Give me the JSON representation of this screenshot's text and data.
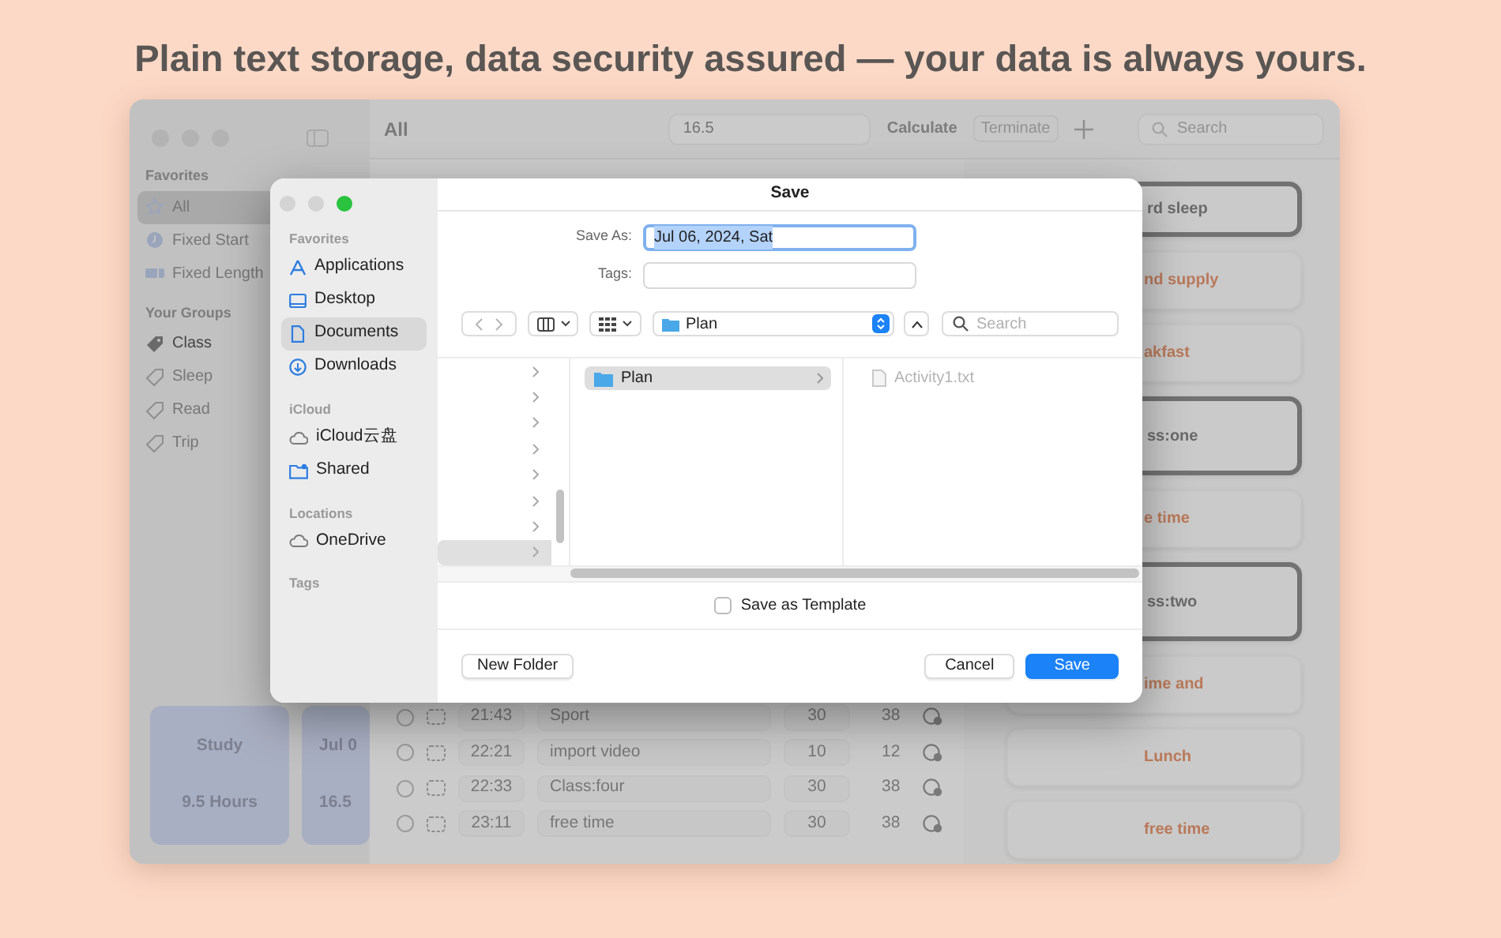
{
  "headline": "Plain text storage, data security assured — your data is always yours.",
  "app": {
    "sidebar": {
      "sections": [
        {
          "title": "Favorites",
          "items": [
            {
              "label": "All",
              "selected": true,
              "dimmed": true
            },
            {
              "label": "Fixed Start",
              "selected": false,
              "dimmed": true
            },
            {
              "label": "Fixed Length",
              "selected": false,
              "dimmed": true
            }
          ]
        },
        {
          "title": "Your Groups",
          "items": [
            {
              "label": "Class",
              "selected": false,
              "dimmed": false
            },
            {
              "label": "Sleep",
              "selected": false,
              "dimmed": true
            },
            {
              "label": "Read",
              "selected": false,
              "dimmed": true
            },
            {
              "label": "Trip",
              "selected": false,
              "dimmed": true
            }
          ]
        }
      ],
      "summary_cards": [
        {
          "title": "Study",
          "value": "9.5 Hours"
        },
        {
          "title": "Jul 0",
          "value": "16.5"
        }
      ]
    },
    "toolbar": {
      "title": "All",
      "value": "16.5",
      "calculate": {
        "label": "Calculate",
        "disabled": false
      },
      "terminate": {
        "label": "Terminate",
        "disabled": true
      },
      "search_placeholder": "Search"
    },
    "rows": [
      {
        "checked": false,
        "time": "21:43",
        "name": "Sport",
        "minutes": "30",
        "total": "38"
      },
      {
        "checked": false,
        "time": "22:21",
        "name": "import video",
        "minutes": "10",
        "total": "12"
      },
      {
        "checked": false,
        "time": "22:33",
        "name": "Class:four",
        "minutes": "30",
        "total": "38"
      },
      {
        "checked": false,
        "time": "23:11",
        "name": "free time",
        "minutes": "30",
        "total": "38"
      }
    ],
    "cards": [
      {
        "label": "rd sleep",
        "selected": true
      },
      {
        "label": "nd supply",
        "selected": false
      },
      {
        "label": "akfast",
        "selected": false
      },
      {
        "label": "ss:one",
        "selected": true
      },
      {
        "label": "e time",
        "selected": false
      },
      {
        "label": "ss:two",
        "selected": true
      },
      {
        "label": "ime and",
        "selected": false
      },
      {
        "label": "Lunch",
        "selected": false
      },
      {
        "label": "free time",
        "selected": false
      }
    ]
  },
  "dialog": {
    "title": "Save",
    "sidebar": [
      {
        "title": "Favorites",
        "items": [
          {
            "label": "Applications",
            "selected": false
          },
          {
            "label": "Desktop",
            "selected": false
          },
          {
            "label": "Documents",
            "selected": true
          },
          {
            "label": "Downloads",
            "selected": false
          }
        ]
      },
      {
        "title": "iCloud",
        "items": [
          {
            "label": "iCloud云盘",
            "selected": false
          },
          {
            "label": "Shared",
            "selected": false
          }
        ]
      },
      {
        "title": "Locations",
        "items": [
          {
            "label": "OneDrive",
            "selected": false
          }
        ]
      },
      {
        "title": "Tags"
      }
    ],
    "save_as": {
      "label": "Save As:",
      "value": "Jul 06, 2024, Sat",
      "selected": true
    },
    "tags": {
      "label": "Tags:"
    },
    "location": "Plan",
    "search_placeholder": "Search",
    "parent_rows": [
      {
        "selected": false
      },
      {
        "selected": false
      },
      {
        "selected": false
      },
      {
        "selected": false
      },
      {
        "selected": false
      },
      {
        "selected": false
      },
      {
        "selected": false
      },
      {
        "selected": true
      }
    ],
    "folders": [
      {
        "name": "Plan",
        "selected": true
      }
    ],
    "files": [
      {
        "name": "Activity1.txt",
        "disabled": true
      }
    ],
    "template": {
      "label": "Save as Template",
      "checked": false
    },
    "buttons": {
      "new_folder": "New Folder",
      "cancel": "Cancel",
      "save": "Save"
    }
  }
}
